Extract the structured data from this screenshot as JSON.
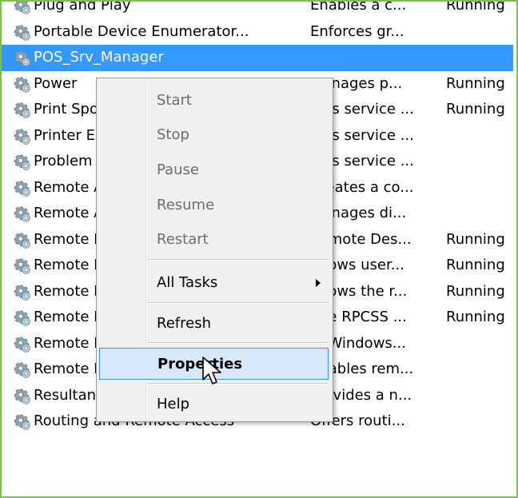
{
  "services": [
    {
      "name": "Plug and Play",
      "description": "Enables a c...",
      "status": "Running",
      "selected": false
    },
    {
      "name": "Portable Device Enumerator...",
      "description": "Enforces gr...",
      "status": "",
      "selected": false
    },
    {
      "name": "POS_Srv_Manager",
      "description": "",
      "status": "",
      "selected": true
    },
    {
      "name": "Power",
      "description": "Manages p...",
      "status": "Running",
      "selected": false
    },
    {
      "name": "Print Spooler",
      "description": "This service ...",
      "status": "Running",
      "selected": false
    },
    {
      "name": "Printer Extensions and Notif...",
      "description": "This service ...",
      "status": "",
      "selected": false
    },
    {
      "name": "Problem Reports and Soluti...",
      "description": "This service ...",
      "status": "",
      "selected": false
    },
    {
      "name": "Remote Access Auto Conne...",
      "description": "Creates a co...",
      "status": "",
      "selected": false
    },
    {
      "name": "Remote Access Connection...",
      "description": "Manages di...",
      "status": "",
      "selected": false
    },
    {
      "name": "Remote Desktop Configurat...",
      "description": "Remote Des...",
      "status": "Running",
      "selected": false
    },
    {
      "name": "Remote Desktop Services",
      "description": "Allows user...",
      "status": "Running",
      "selected": false
    },
    {
      "name": "Remote Desktop Services U...",
      "description": "Allows the r...",
      "status": "Running",
      "selected": false
    },
    {
      "name": "Remote Procedure Call (RPC)",
      "description": "The RPCSS ...",
      "status": "Running",
      "selected": false
    },
    {
      "name": "Remote Procedure Call (RP...",
      "description": "In Windows...",
      "status": "",
      "selected": false
    },
    {
      "name": "Remote Registry",
      "description": "Enables rem...",
      "status": "",
      "selected": false
    },
    {
      "name": "Resultant Set of Policy Provi...",
      "description": "Provides a n...",
      "status": "",
      "selected": false
    },
    {
      "name": "Routing and Remote Access",
      "description": "Offers routi...",
      "status": "",
      "selected": false
    }
  ],
  "context_menu": {
    "start": "Start",
    "stop": "Stop",
    "pause": "Pause",
    "resume": "Resume",
    "restart": "Restart",
    "all_tasks": "All Tasks",
    "refresh": "Refresh",
    "properties": "Properties",
    "help": "Help"
  },
  "colors": {
    "selection": "#3399ff",
    "menu_hover": "#d7e8fa",
    "menu_hover_border": "#3f91de",
    "frame_border": "#7cc243"
  },
  "icons": {
    "service": "gear-icon",
    "submenu": "chevron-right-icon",
    "pointer": "mouse-cursor-icon"
  }
}
